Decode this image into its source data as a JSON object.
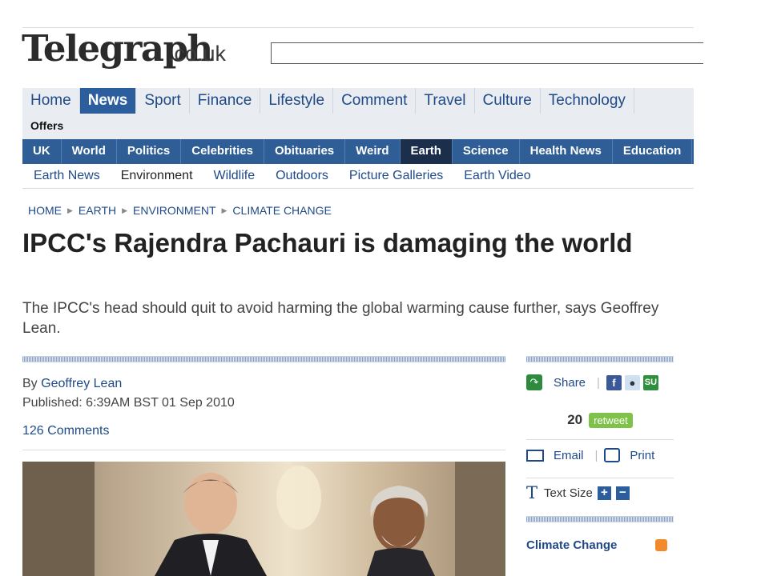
{
  "masthead": {
    "logo": "Telegraph",
    "logo_suffix": ".co.uk",
    "search_value": ""
  },
  "nav_primary": [
    {
      "label": "Home",
      "active": false
    },
    {
      "label": "News",
      "active": true
    },
    {
      "label": "Sport",
      "active": false
    },
    {
      "label": "Finance",
      "active": false
    },
    {
      "label": "Lifestyle",
      "active": false
    },
    {
      "label": "Comment",
      "active": false
    },
    {
      "label": "Travel",
      "active": false
    },
    {
      "label": "Culture",
      "active": false
    },
    {
      "label": "Technology",
      "active": false
    }
  ],
  "nav_primary_row2": [
    "Offers"
  ],
  "nav_secondary": [
    {
      "label": "UK",
      "active": false
    },
    {
      "label": "World",
      "active": false
    },
    {
      "label": "Politics",
      "active": false
    },
    {
      "label": "Celebrities",
      "active": false
    },
    {
      "label": "Obituaries",
      "active": false
    },
    {
      "label": "Weird",
      "active": false
    },
    {
      "label": "Earth",
      "active": true
    },
    {
      "label": "Science",
      "active": false
    },
    {
      "label": "Health News",
      "active": false
    },
    {
      "label": "Education",
      "active": false
    }
  ],
  "nav_tertiary": [
    {
      "label": "Earth News",
      "active": false
    },
    {
      "label": "Environment",
      "active": true
    },
    {
      "label": "Wildlife",
      "active": false
    },
    {
      "label": "Outdoors",
      "active": false
    },
    {
      "label": "Picture Galleries",
      "active": false
    },
    {
      "label": "Earth Video",
      "active": false
    }
  ],
  "breadcrumb": [
    "HOME",
    "EARTH",
    "ENVIRONMENT",
    "CLIMATE CHANGE"
  ],
  "article": {
    "headline": "IPCC's Rajendra Pachauri is damaging the world",
    "standfirst": "The IPCC's head should quit to avoid harming the global warming cause further, says Geoffrey Lean.",
    "byline_prefix": "By",
    "author": "Geoffrey Lean",
    "published": "Published: 6:39AM BST 01 Sep 2010",
    "comments": "126 Comments"
  },
  "sidebar": {
    "share_label": "Share",
    "retweet_count": "20",
    "retweet_label": "retweet",
    "email_label": "Email",
    "print_label": "Print",
    "text_size_label": "Text Size",
    "text_size_up": "+",
    "text_size_down": "−",
    "topic": "Climate Change"
  },
  "colors": {
    "brand_blue": "#2c5e9e",
    "nav_dark": "#1b2f4d",
    "link": "#1f4a87",
    "retweet_green": "#7fc24a",
    "rss_orange": "#f28a2b"
  }
}
